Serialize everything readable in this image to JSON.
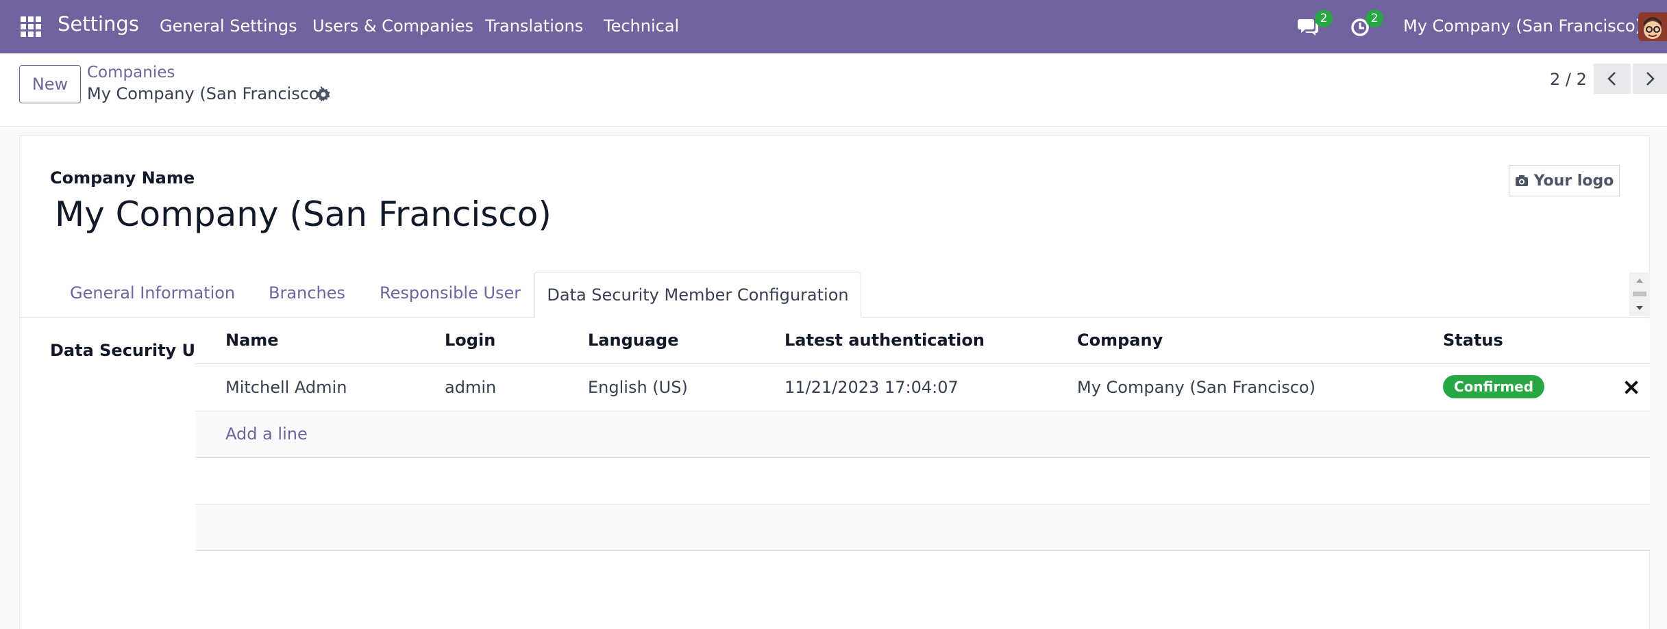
{
  "navbar": {
    "app_name": "Settings",
    "menus": [
      "General Settings",
      "Users & Companies",
      "Translations",
      "Technical"
    ],
    "messages_count": "2",
    "activities_count": "2",
    "company": "My Company (San Francisco)"
  },
  "control": {
    "new_label": "New",
    "breadcrumb_parent": "Companies",
    "breadcrumb_current": "My Company (San Francisco)",
    "pager": "2 / 2"
  },
  "form": {
    "company_name_label": "Company Name",
    "company_name": "My Company (San Francisco)",
    "logo_label": "Your logo",
    "tabs": [
      "General Information",
      "Branches",
      "Responsible User",
      "Data Security Member Configuration"
    ],
    "active_tab": "Data Security Member Configuration",
    "field_label": "Data Security User"
  },
  "table": {
    "headers": [
      "Name",
      "Login",
      "Language",
      "Latest authentication",
      "Company",
      "Status"
    ],
    "rows": [
      {
        "name": "Mitchell Admin",
        "login": "admin",
        "language": "English (US)",
        "latest_auth": "11/21/2023 17:04:07",
        "company": "My Company (San Francisco)",
        "status": "Confirmed"
      }
    ],
    "add_line": "Add a line"
  },
  "colors": {
    "primary": "#71639e",
    "success": "#28a745"
  }
}
